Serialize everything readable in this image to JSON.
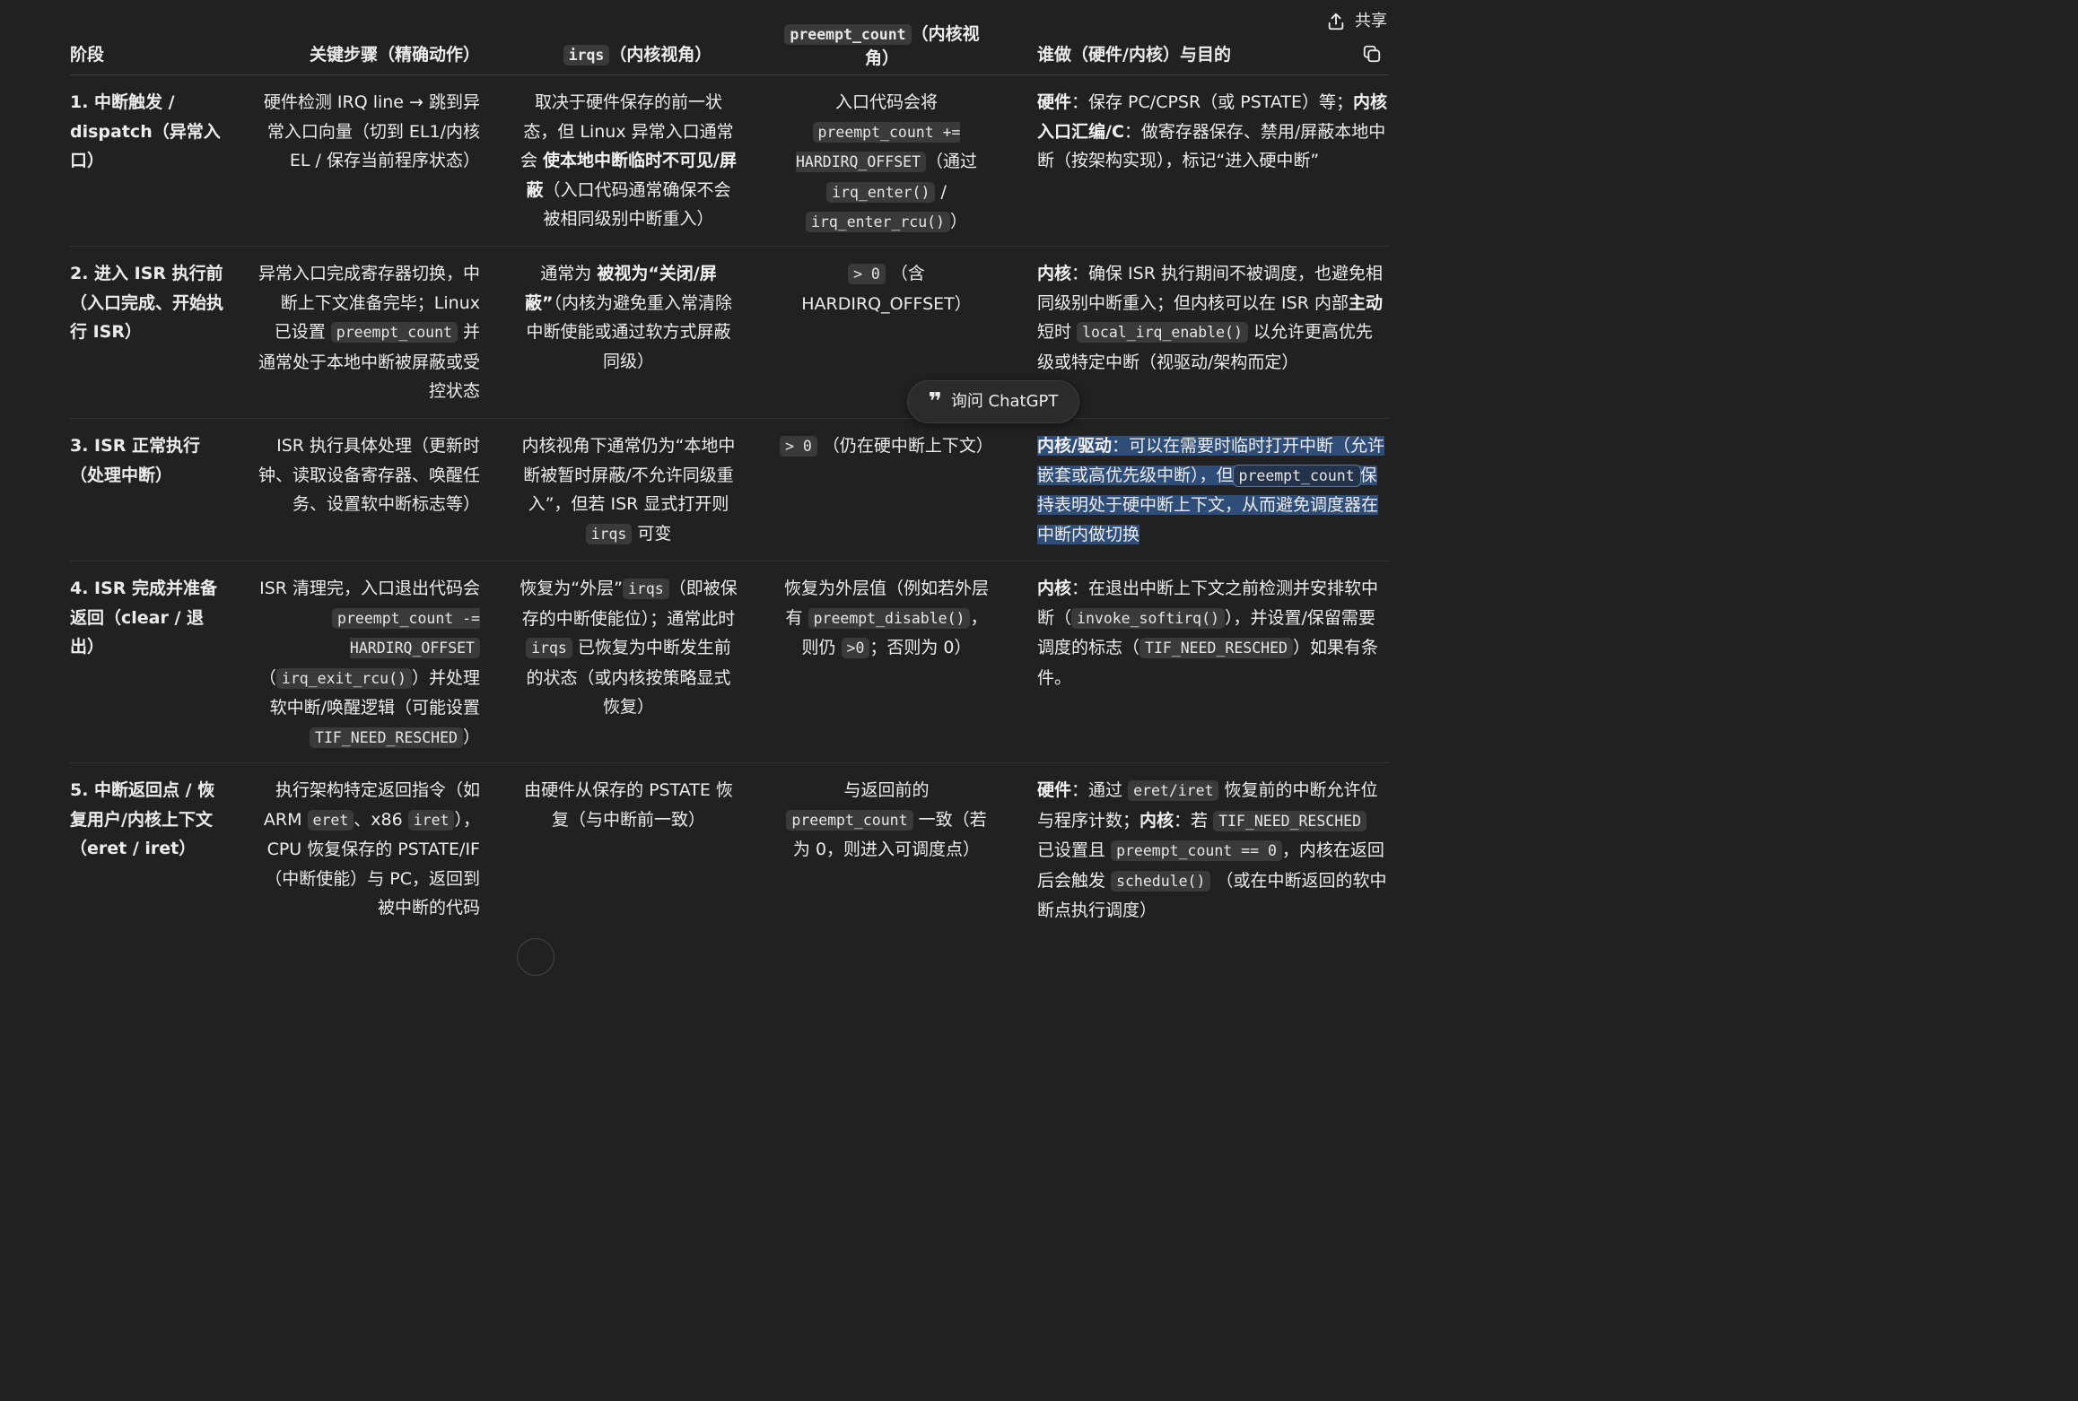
{
  "toolbar": {
    "share_label": "共享"
  },
  "ask_chatgpt": {
    "label": "询问 ChatGPT"
  },
  "table": {
    "headers": {
      "c1": "阶段",
      "c2": "关键步骤（精确动作）",
      "c3_code": "irqs",
      "c3_text": "（内核视角）",
      "c4_code": "preempt_count",
      "c4_text": "（内核视角）",
      "c5": "谁做（硬件/内核）与目的"
    },
    "rows": [
      {
        "stage": "1. 中断触发 / dispatch（异常入口）",
        "c2": "硬件检测 IRQ line → 跳到异常入口向量（切到 EL1/内核 EL / 保存当前程序状态）",
        "c3_a": "取决于硬件保存的前一状态，但 Linux 异常入口通常会",
        "c3_bold": "使本地中断临时不可见/屏蔽",
        "c3_b": "（入口代码通常确保不会被相同级别中断重入）",
        "c4_a": "入口代码会将",
        "c4_code1": "preempt_count += HARDIRQ_OFFSET",
        "c4_b": "（通过",
        "c4_code2": "irq_enter()",
        "c4_c": "/",
        "c4_code3": "irq_enter_rcu()",
        "c4_d": "）",
        "c5_b1": "硬件",
        "c5_a": "：保存 PC/CPSR（或 PSTATE）等；",
        "c5_b2": "内核入口汇编/C",
        "c5_c": "：做寄存器保存、禁用/屏蔽本地中断（按架构实现），标记“进入硬中断”"
      },
      {
        "stage": "2. 进入 ISR 执行前（入口完成、开始执行 ISR）",
        "c2_a": "异常入口完成寄存器切换，中断上下文准备完毕；Linux 已设置",
        "c2_code": "preempt_count",
        "c2_b": "并通常处于本地中断被屏蔽或受控状态",
        "c3_a": "通常为",
        "c3_bold": "被视为“关闭/屏蔽”",
        "c3_b": "（内核为避免重入常清除中断使能或通过软方式屏蔽同级）",
        "c4_code": "> 0",
        "c4_a": "（含 HARDIRQ_OFFSET）",
        "c5_b1": "内核",
        "c5_a": "：确保 ISR 执行期间不被调度，也避免相同级别中断重入；但内核可以在 ISR 内部",
        "c5_b2": "主动",
        "c5_b": "短时",
        "c5_code": "local_irq_enable()",
        "c5_c": "以允许更高优先级或特定中断（视驱动/架构而定）"
      },
      {
        "stage": "3. ISR 正常执行（处理中断）",
        "c2": "ISR 执行具体处理（更新时钟、读取设备寄存器、唤醒任务、设置软中断标志等）",
        "c3_a": "内核视角下通常仍为“本地中断被暂时屏蔽/不允许同级重入”，但若 ISR 显式打开则",
        "c3_code": "irqs",
        "c3_b": "可变",
        "c4_code": "> 0",
        "c4_a": "（仍在硬中断上下文）",
        "c5_b1": "内核/驱动",
        "c5_a": "：可以在需要时临时打开中断（允许嵌套或高优先级中断），但",
        "c5_code": "preempt_count",
        "c5_b": "保持表明处于硬中断上下文，从而避免调度器在中断内做切换"
      },
      {
        "stage": "4. ISR 完成并准备返回（clear / 退出）",
        "c2_a": "ISR 清理完，入口退出代码会",
        "c2_code1": "preempt_count -= HARDIRQ_OFFSET",
        "c2_b": "（",
        "c2_code2": "irq_exit_rcu()",
        "c2_c": "）并处理软中断/唤醒逻辑（可能设置",
        "c2_code3": "TIF_NEED_RESCHED",
        "c2_d": "）",
        "c3_a": "恢复为“外层”",
        "c3_code1": "irqs",
        "c3_b": "（即被保存的中断使能位）；通常此时",
        "c3_code2": "irqs",
        "c3_c": "已恢复为中断发生前的状态（或内核按策略显式恢复）",
        "c4_a": "恢复为外层值（例如若外层有",
        "c4_code1": "preempt_disable()",
        "c4_b": "，则仍",
        "c4_code2": ">0",
        "c4_c": "；否则为 0）",
        "c5_b1": "内核",
        "c5_a": "：在退出中断上下文之前检测并安排软中断（",
        "c5_code1": "invoke_softirq()",
        "c5_b": "），并设置/保留需要调度的标志（",
        "c5_code2": "TIF_NEED_RESCHED",
        "c5_c": "）如果有条件。"
      },
      {
        "stage": "5. 中断返回点 / 恢复用户/内核上下文（eret / iret）",
        "c2_a": "执行架构特定返回指令（如 ARM",
        "c2_code1": "eret",
        "c2_b": "、x86",
        "c2_code2": "iret",
        "c2_c": "），CPU 恢复保存的 PSTATE/IF（中断使能）与 PC，返回到被中断的代码",
        "c3": "由硬件从保存的 PSTATE 恢复（与中断前一致）",
        "c4_a": "与返回前的",
        "c4_code": "preempt_count",
        "c4_b": "一致（若为 0，则进入可调度点）",
        "c5_b1": "硬件",
        "c5_a": "：通过",
        "c5_code1": "eret/iret",
        "c5_b": "恢复前的中断允许位与程序计数；",
        "c5_b2": "内核",
        "c5_c": "：若",
        "c5_code2": "TIF_NEED_RESCHED",
        "c5_d": "已设置且",
        "c5_code3": "preempt_count == 0",
        "c5_e": "，内核在返回后会触发",
        "c5_code4": "schedule()",
        "c5_f": "（或在中断返回的软中断点执行调度）"
      }
    ]
  }
}
